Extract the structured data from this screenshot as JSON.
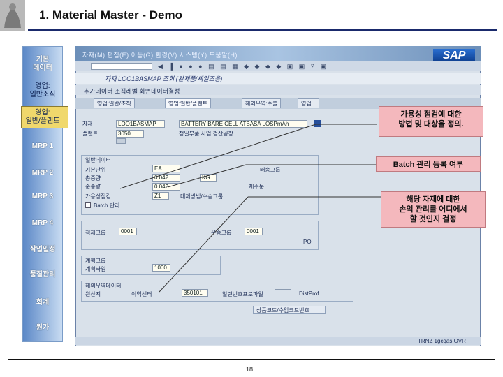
{
  "header": {
    "title": "1. Material Master - Demo"
  },
  "nav": {
    "items": [
      {
        "label": "기본\n데이터"
      },
      {
        "label": "영업:\n일반조직"
      },
      {
        "label": "영업:\n일반/플랜트"
      },
      {
        "label": "MRP 1"
      },
      {
        "label": "MRP 2"
      },
      {
        "label": "MRP 3"
      },
      {
        "label": "MRP 4"
      },
      {
        "label": "작업일정"
      },
      {
        "label": "품질관리"
      },
      {
        "label": "회계"
      },
      {
        "label": "원가"
      }
    ]
  },
  "sap": {
    "menu": "자재(M)  편집(E)  이동(G)  환경(V)  시스템(Y)  도움말(H)",
    "logo": "SAP",
    "window_title": "자재 LOO1BASMAP 조회 (완제품/세일즈용)",
    "toolbar_label": "추가데이터   조직레벨   화면데이터결정",
    "tabs": [
      "영업:일반/조직",
      "영업:일반/플랜트",
      "해외무역:수출",
      "영업..."
    ],
    "material_label": "자재",
    "material_value": "LOO1BASMAP",
    "material_desc": "BATTERY BARE CELL ATBASA LOSPmAh",
    "plant_label": "플랜트",
    "plant_value": "3050",
    "plant_desc": "정밀부품 사업 경산공장",
    "general_data_label": "일반데이터",
    "unit_label": "기본단위",
    "unit_value": "EA",
    "weight_label": "총중량",
    "weight_value": "0.042",
    "net_label": "순중량",
    "net_value": "0.042",
    "avail_label": "가용성점검",
    "avail_value": "Z1",
    "batch_label": "Batch 관리",
    "group_label": "배송그룹",
    "repl_label": "대체방법/수송그룹",
    "replenish_label": "재주문",
    "loading_label": "적재그룹",
    "loading_value": "0001",
    "shipping_label": "운송그룹",
    "shipping_value": "0001",
    "profit_label": "이익센터",
    "profit_value": "350101",
    "plan_label": "계획타입",
    "plan_value": "1000",
    "plan_group_label": "계획그룹",
    "foreign_label": "해외무역데이터",
    "foreign_origin_label": "원산지",
    "serial_label": "일련번호프로파일",
    "dist_label": "DistProf",
    "commodity_label": "상품코드/수입코드번호",
    "status_text": "TRNZ  1gcqas  OVR",
    "weight_unit": "KG",
    "po_label": "PO"
  },
  "callouts": {
    "availability": "가용성 점검에 대한\n방법 및 대상을 정의.",
    "batch": "Batch 관리 등록 여부",
    "profit_center": "해당 자재에 대한\n손익 관리를 어디에서\n할 것인지 결정"
  },
  "footer": {
    "page_number": "18"
  }
}
